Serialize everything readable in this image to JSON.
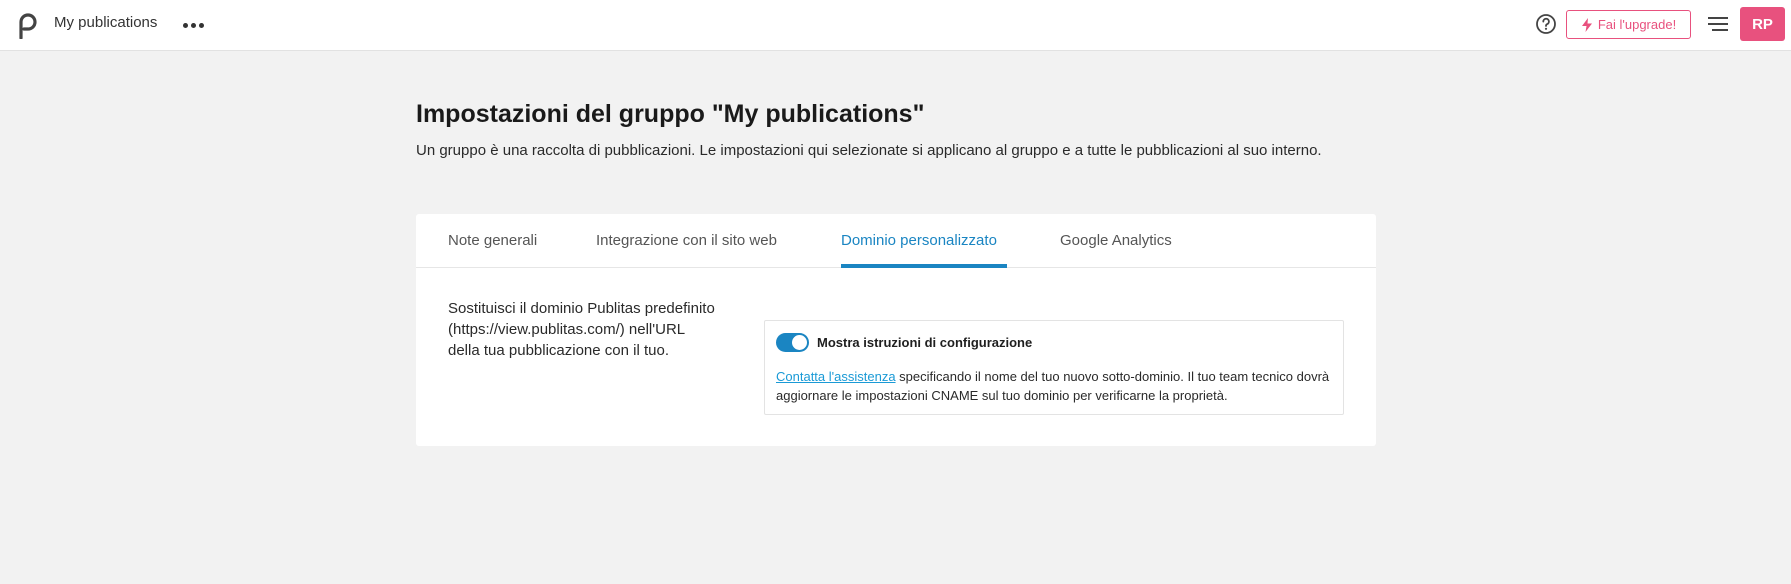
{
  "header": {
    "title": "My publications",
    "logo_icon": "publitas-logo-icon",
    "upgrade_label": "Fai l'upgrade!",
    "avatar_initials": "RP",
    "brand_color": "#e8517e"
  },
  "page": {
    "title": "Impostazioni del gruppo \"My publications\"",
    "description": "Un gruppo è una raccolta di pubblicazioni. Le impostazioni qui selezionate si applicano al gruppo e a tutte le pubblicazioni al suo interno."
  },
  "tabs": [
    {
      "label": "Note generali",
      "active": false
    },
    {
      "label": "Integrazione con il sito web",
      "active": false
    },
    {
      "label": "Dominio personalizzato",
      "active": true
    },
    {
      "label": "Google Analytics",
      "active": false
    }
  ],
  "domain_setting": {
    "description": "Sostituisci il dominio Publitas predefinito (https://view.publitas.com/) nell'URL della tua pubblicazione con il tuo.",
    "toggle_label": "Mostra istruzioni di configurazione",
    "toggle_on": true,
    "support_link": "Contatta l'assistenza",
    "instructions": " specificando il nome del tuo nuovo sotto-dominio. Il tuo team tecnico dovrà aggiornare le impostazioni CNAME sul tuo dominio per verificarne la proprietà."
  },
  "accent_color": "#1a85c2"
}
